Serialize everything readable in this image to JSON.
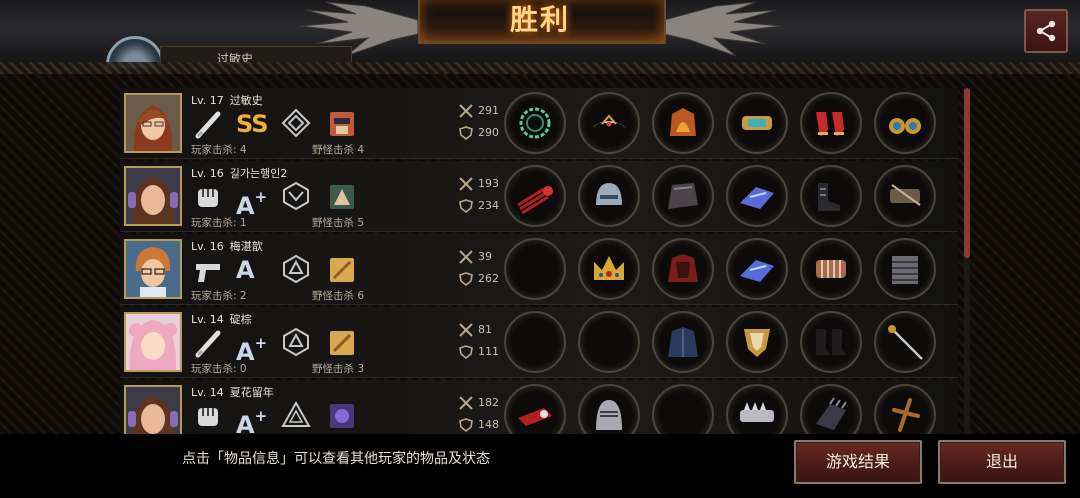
{
  "header": {
    "title": "胜利",
    "tab_label": "过敏史"
  },
  "stats_labels": {
    "player_kills": "玩家击杀",
    "monster_kills": "野怪击杀"
  },
  "players": [
    {
      "level": "Lv. 17",
      "name": "过敏史",
      "grade": "SS",
      "weapon": "bat-icon",
      "player_kills": "玩家击杀: 4",
      "monster_kills": "野怪击杀 4",
      "attack": "291",
      "defense": "290",
      "items": [
        "spiked-wreath",
        "winged-tiara",
        "flame-armor",
        "jeweled-bracer",
        "red-heels",
        "gold-earrings"
      ]
    },
    {
      "level": "Lv. 16",
      "name": "길가는행인2",
      "grade": "A+",
      "weapon": "fist-icon",
      "player_kills": "玩家击杀: 1",
      "monster_kills": "野怪击杀 5",
      "attack": "193",
      "defense": "234",
      "items": [
        "red-claws",
        "steel-helmet",
        "dark-armor",
        "crystal-bracer",
        "black-boots",
        "bow-bracer"
      ]
    },
    {
      "level": "Lv. 16",
      "name": "梅湛歆",
      "grade": "A",
      "weapon": "pistol-icon",
      "player_kills": "玩家击杀: 2",
      "monster_kills": "野怪击杀 6",
      "attack": "39",
      "defense": "262",
      "items": [
        "empty",
        "royal-crown",
        "crimson-armor",
        "crystal-bracer",
        "bandaged-bracer",
        "chain-boots"
      ]
    },
    {
      "level": "Lv. 14",
      "name": "碇棕",
      "grade": "A+",
      "weapon": "bat-icon",
      "player_kills": "玩家击杀: 0",
      "monster_kills": "野怪击杀 3",
      "attack": "81",
      "defense": "111",
      "items": [
        "empty",
        "empty",
        "blue-coat",
        "gold-shield",
        "leather-boots",
        "rapier"
      ]
    },
    {
      "level": "Lv. 14",
      "name": "夏花留年",
      "grade": "A+",
      "weapon": "fist-icon",
      "player_kills": "",
      "monster_kills": "",
      "attack": "182",
      "defense": "148",
      "items": [
        "red-skull-gauntlet",
        "knight-helmet",
        "empty",
        "spiked-bracer",
        "dark-gauntlet",
        "wooden-cross"
      ]
    }
  ],
  "footer": {
    "hint": "点击「物品信息」可以查看其他玩家的物品及状态",
    "result_button": "游戏结果",
    "quit_button": "退出"
  },
  "colors": {
    "title_glow": "#ff7a1a",
    "button_red": "#6a2a22",
    "grade_ss": "#f0b030",
    "scroll_thumb": "#8a3a2e"
  }
}
